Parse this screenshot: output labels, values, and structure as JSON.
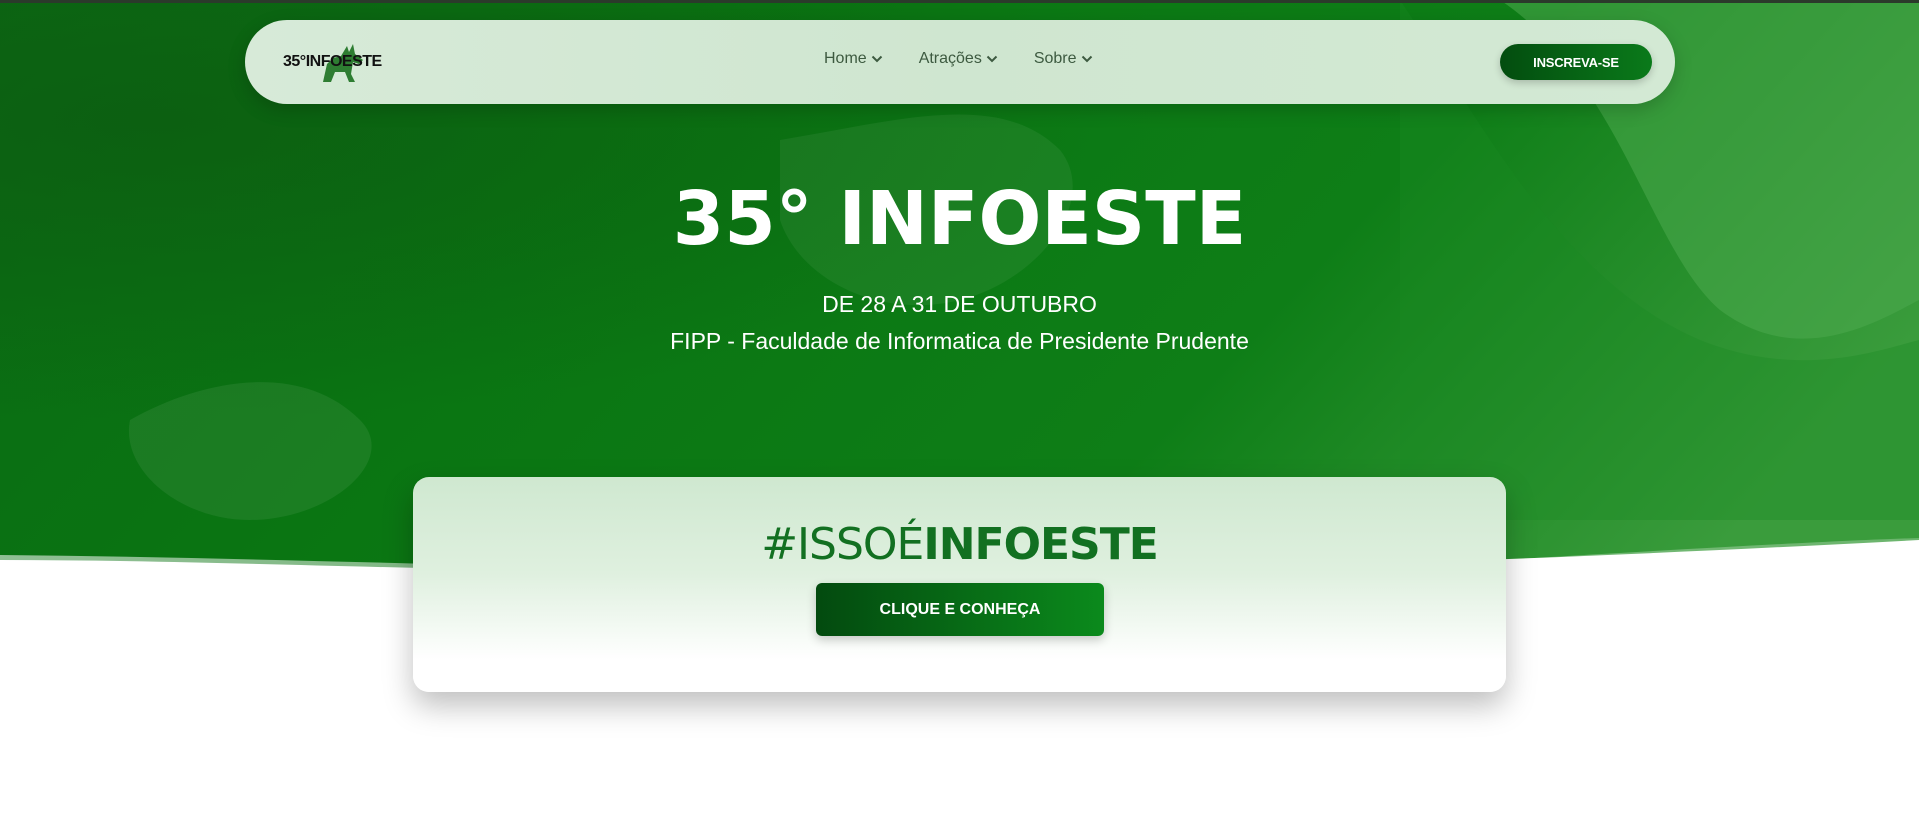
{
  "navbar": {
    "logo_text": "35°INFOESTE",
    "menu": [
      {
        "label": "Home"
      },
      {
        "label": "Atrações"
      },
      {
        "label": "Sobre"
      }
    ],
    "cta_label": "INSCREVA-SE"
  },
  "hero": {
    "title": "35° INFOESTE",
    "date": "DE 28 A 31 DE OUTUBRO",
    "place": "FIPP - Faculdade de Informatica de Presidente Prudente"
  },
  "card": {
    "hashtag_light": "#ISSOÉ",
    "hashtag_bold": "INFOESTE",
    "button_label": "CLIQUE E CONHEÇA"
  },
  "colors": {
    "primary_green": "#0a7a1a",
    "dark_green": "#034d0f",
    "nav_bg": "#d3e9d4"
  }
}
